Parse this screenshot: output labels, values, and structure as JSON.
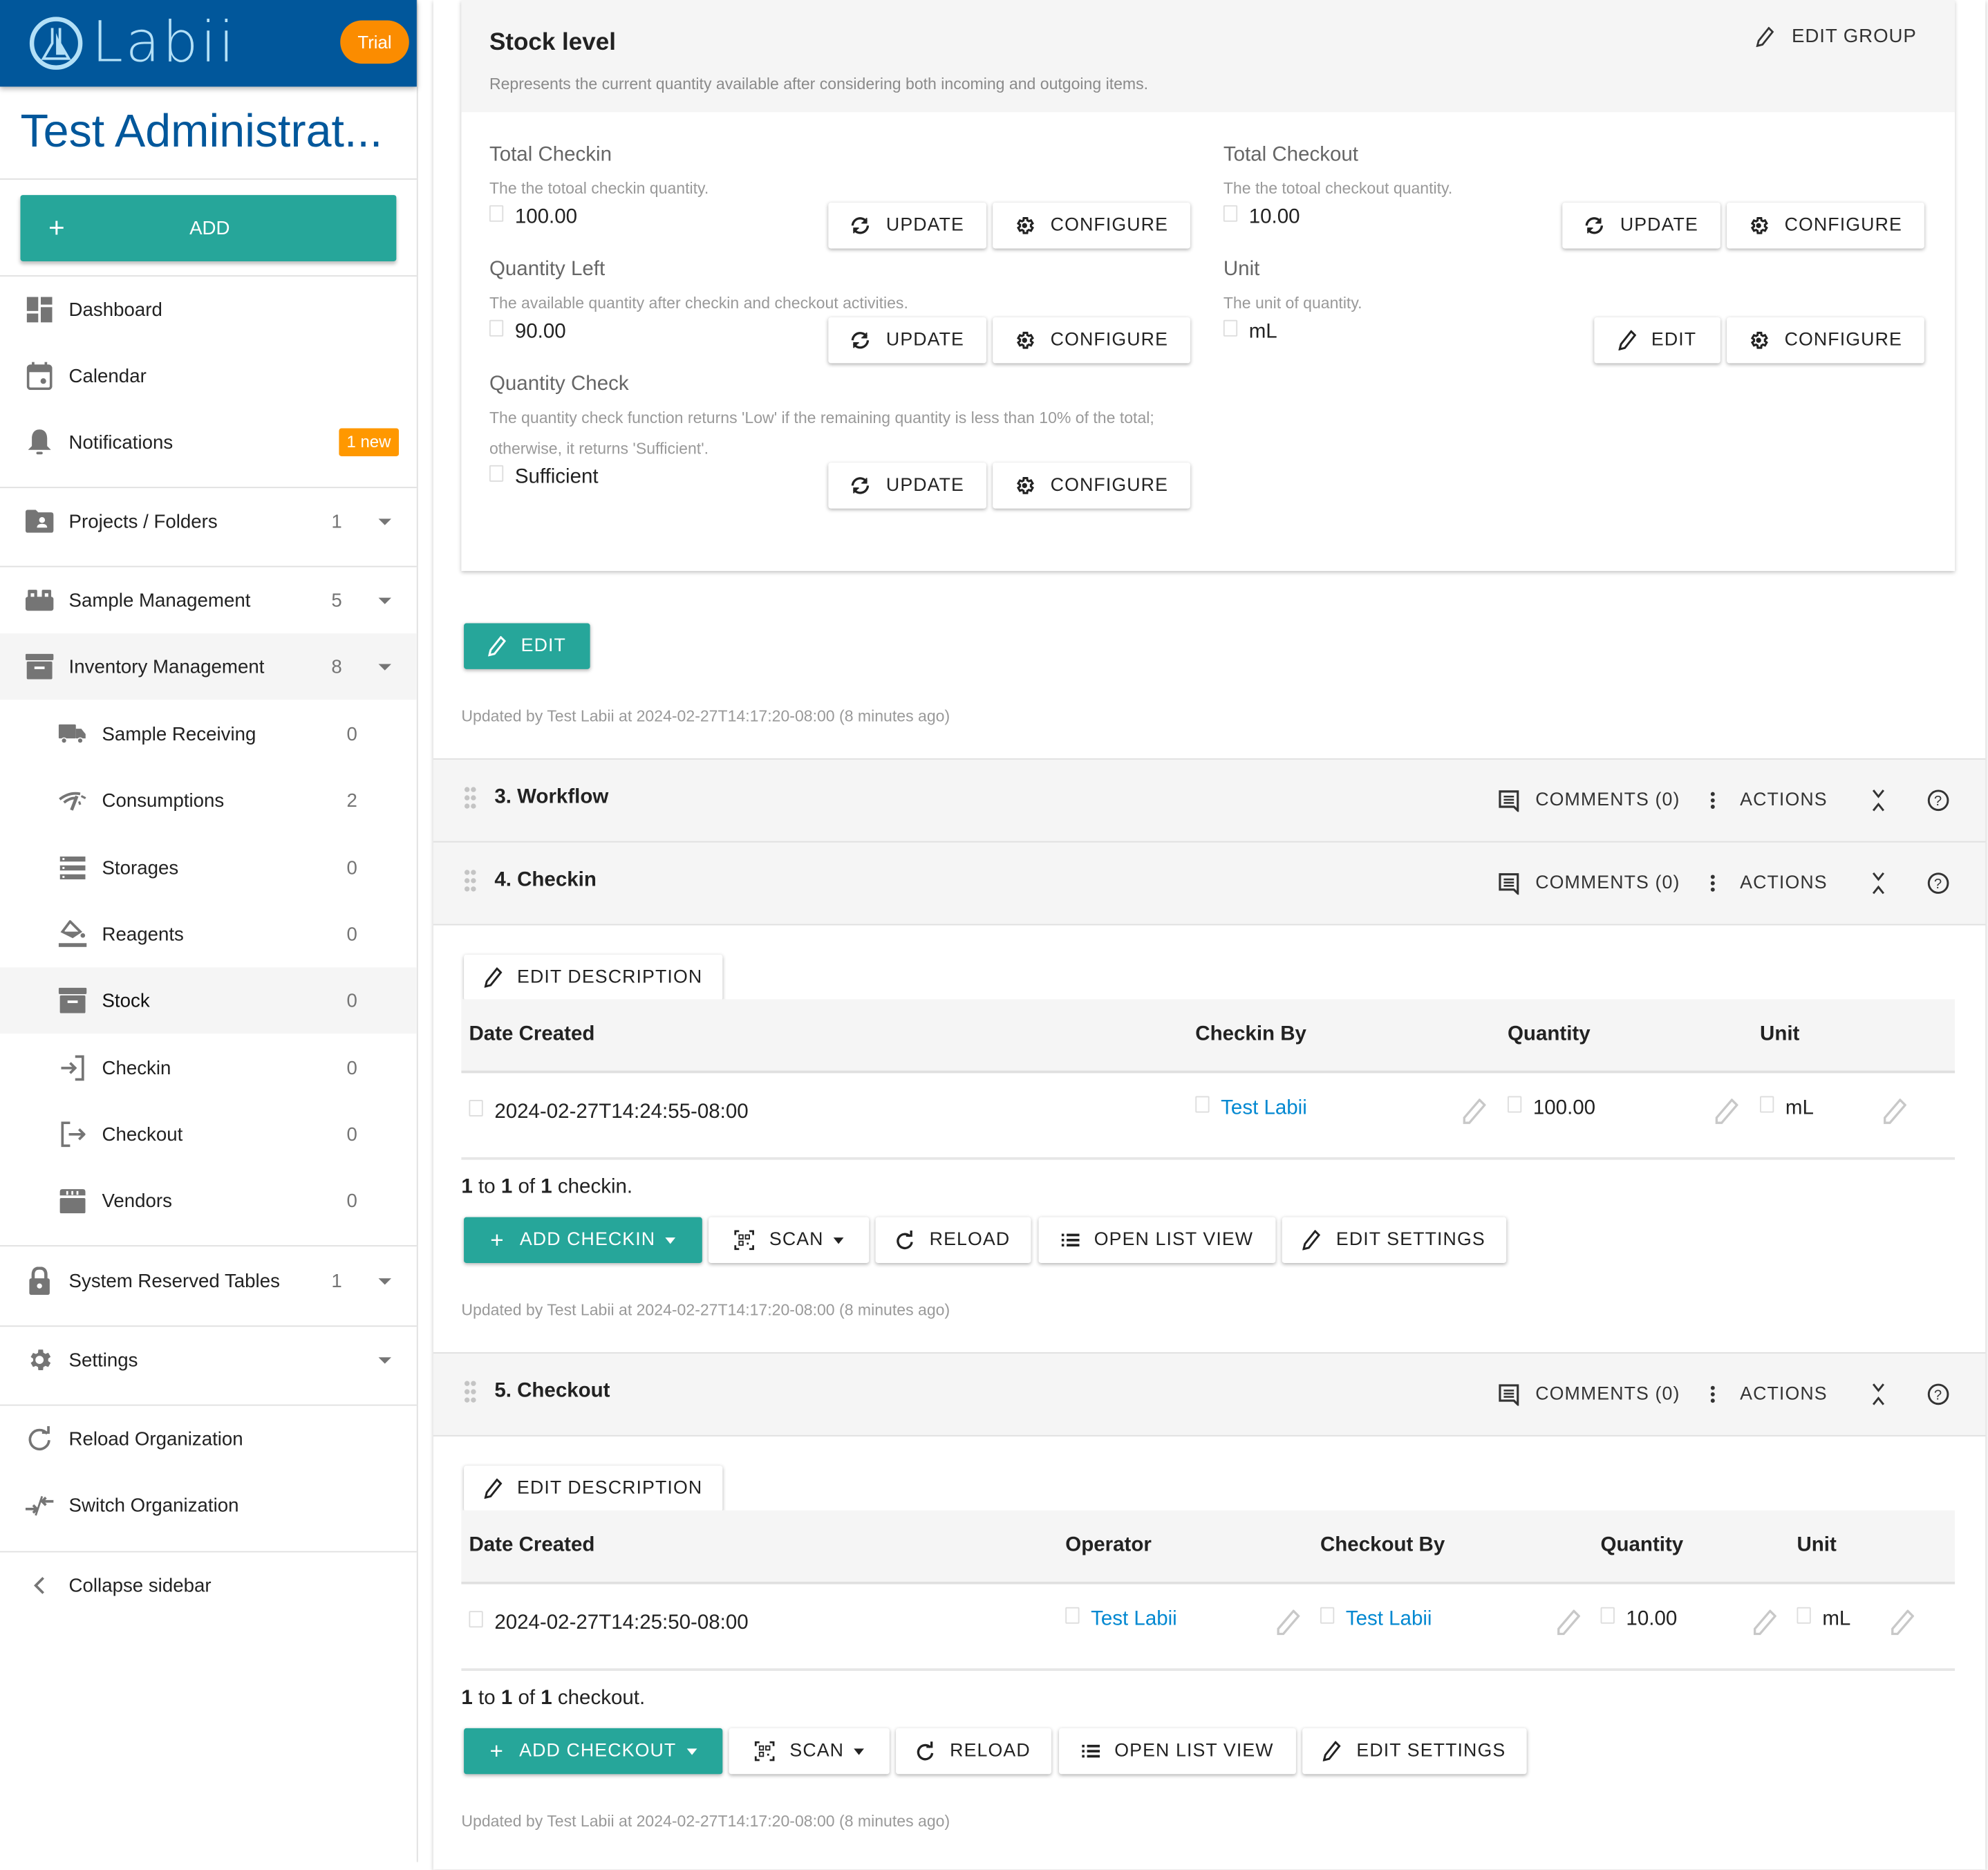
{
  "brand": {
    "name": "Labii",
    "trial_label": "Trial"
  },
  "organization": {
    "title": "Test Administrat..."
  },
  "sidebar": {
    "add_label": "ADD",
    "items": [
      {
        "label": "Dashboard",
        "icon": "dashboard-icon"
      },
      {
        "label": "Calendar",
        "icon": "calendar-icon"
      },
      {
        "label": "Notifications",
        "icon": "bell-icon",
        "badge": "1 new"
      },
      {
        "label": "Projects / Folders",
        "icon": "folder-shared-icon",
        "count": "1"
      },
      {
        "label": "Sample Management",
        "icon": "sample-management-icon",
        "count": "5"
      },
      {
        "label": "Inventory Management",
        "icon": "archive-icon",
        "count": "8"
      },
      {
        "label": "Sample Receiving",
        "icon": "truck-icon",
        "count": "0"
      },
      {
        "label": "Consumptions",
        "icon": "consumption-icon",
        "count": "2"
      },
      {
        "label": "Storages",
        "icon": "storage-icon",
        "count": "0"
      },
      {
        "label": "Reagents",
        "icon": "reagent-icon",
        "count": "0"
      },
      {
        "label": "Stock",
        "icon": "archive-icon",
        "count": "0"
      },
      {
        "label": "Checkin",
        "icon": "checkin-icon",
        "count": "0"
      },
      {
        "label": "Checkout",
        "icon": "checkout-icon",
        "count": "0"
      },
      {
        "label": "Vendors",
        "icon": "store-icon",
        "count": "0"
      },
      {
        "label": "System Reserved Tables",
        "icon": "lock-icon",
        "count": "1"
      },
      {
        "label": "Settings",
        "icon": "gear-icon"
      },
      {
        "label": "Reload Organization",
        "icon": "reload-icon"
      },
      {
        "label": "Switch Organization",
        "icon": "switch-icon"
      },
      {
        "label": "Collapse sidebar",
        "icon": "chevron-left-icon"
      }
    ]
  },
  "stock_level": {
    "title": "Stock level",
    "description": "Represents the current quantity available after considering both incoming and outgoing items.",
    "edit_group_label": "EDIT GROUP",
    "fields": [
      {
        "title": "Total Checkin",
        "description": "The the totoal checkin quantity.",
        "value": "100.00",
        "buttons": [
          "UPDATE",
          "CONFIGURE"
        ]
      },
      {
        "title": "Total Checkout",
        "description": "The the totoal checkout quantity.",
        "value": "10.00",
        "buttons": [
          "UPDATE",
          "CONFIGURE"
        ]
      },
      {
        "title": "Quantity Left",
        "description": "The available quantity after checkin and checkout activities.",
        "value": "90.00",
        "buttons": [
          "UPDATE",
          "CONFIGURE"
        ]
      },
      {
        "title": "Unit",
        "description": "The unit of quantity.",
        "value": "mL",
        "buttons": [
          "EDIT",
          "CONFIGURE"
        ]
      },
      {
        "title": "Quantity Check",
        "description_line1": "The quantity check function returns 'Low' if the remaining quantity is less than 10% of the total;",
        "description_line2": "otherwise, it returns 'Sufficient'.",
        "value": "Sufficient",
        "buttons": [
          "UPDATE",
          "CONFIGURE"
        ]
      }
    ],
    "edit_label": "EDIT",
    "updated": "Updated by Test Labii at 2024-02-27T14:17:20-08:00 (8 minutes ago)"
  },
  "section_tools": {
    "comments": "COMMENTS (0)",
    "actions": "ACTIONS"
  },
  "sections": {
    "workflow": {
      "title": "3. Workflow"
    },
    "checkin": {
      "title": "4. Checkin",
      "edit_description": "EDIT DESCRIPTION",
      "columns": [
        "Date Created",
        "Checkin By",
        "Quantity",
        "Unit"
      ],
      "rows": [
        {
          "date_created": "2024-02-27T14:24:55-08:00",
          "checkin_by": "Test Labii",
          "quantity": "100.00",
          "unit": "mL"
        }
      ],
      "pager": {
        "from": "1",
        "to_word": "to",
        "to": "1",
        "of_word": "of",
        "total": "1",
        "noun": "checkin."
      },
      "buttons": {
        "add": "ADD CHECKIN",
        "scan": "SCAN",
        "reload": "RELOAD",
        "list_view": "OPEN LIST VIEW",
        "edit_settings": "EDIT SETTINGS"
      },
      "updated": "Updated by Test Labii at 2024-02-27T14:17:20-08:00 (8 minutes ago)"
    },
    "checkout": {
      "title": "5. Checkout",
      "edit_description": "EDIT DESCRIPTION",
      "columns": [
        "Date Created",
        "Operator",
        "Checkout By",
        "Quantity",
        "Unit"
      ],
      "rows": [
        {
          "date_created": "2024-02-27T14:25:50-08:00",
          "operator": "Test Labii",
          "checkout_by": "Test Labii",
          "quantity": "10.00",
          "unit": "mL"
        }
      ],
      "pager": {
        "from": "1",
        "to_word": "to",
        "to": "1",
        "of_word": "of",
        "total": "1",
        "noun": "checkout."
      },
      "buttons": {
        "add": "ADD CHECKOUT",
        "scan": "SCAN",
        "reload": "RELOAD",
        "list_view": "OPEN LIST VIEW",
        "edit_settings": "EDIT SETTINGS"
      },
      "updated": "Updated by Test Labii at 2024-02-27T14:17:20-08:00 (8 minutes ago)"
    }
  },
  "colors": {
    "brand_blue": "#01579b",
    "teal": "#26a69a",
    "orange": "#fb8c00",
    "link": "#0288d1"
  }
}
